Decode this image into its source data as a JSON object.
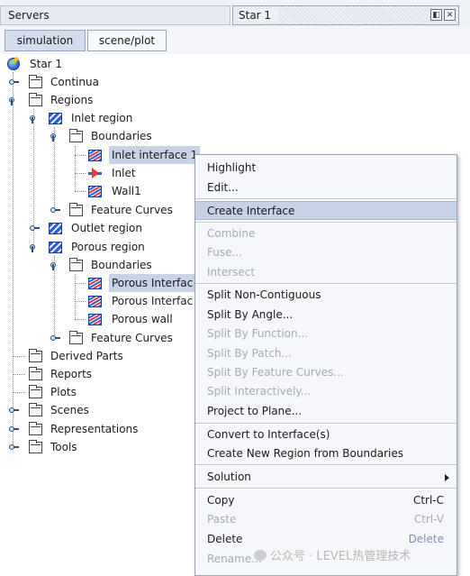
{
  "header": {
    "servers_label": "Servers",
    "tab_title": "Star 1",
    "restore_glyph": "◧",
    "close_glyph": "✕"
  },
  "tabs": [
    {
      "label": "simulation",
      "active": true
    },
    {
      "label": "scene/plot",
      "active": false
    }
  ],
  "tree": {
    "root": "Star 1",
    "continua": "Continua",
    "regions": "Regions",
    "inlet_region": "Inlet region",
    "boundaries": "Boundaries",
    "inlet_interface": "Inlet interface 1",
    "inlet": "Inlet",
    "wall1": "Wall1",
    "feature_curves": "Feature Curves",
    "outlet_region": "Outlet region",
    "porous_region": "Porous region",
    "porous_interface_a": "Porous Interfac",
    "porous_interface_b": "Porous Interfac",
    "porous_wall": "Porous wall",
    "derived_parts": "Derived Parts",
    "reports": "Reports",
    "plots": "Plots",
    "scenes": "Scenes",
    "representations": "Representations",
    "tools": "Tools"
  },
  "menu": {
    "highlight": "Highlight",
    "edit": "Edit...",
    "create_interface": "Create Interface",
    "combine": "Combine",
    "fuse": "Fuse...",
    "intersect": "Intersect",
    "split_non_contiguous": "Split Non-Contiguous",
    "split_by_angle": "Split By Angle...",
    "split_by_function": "Split By Function...",
    "split_by_patch": "Split By Patch...",
    "split_by_feature_curves": "Split By Feature Curves...",
    "split_interactively": "Split Interactively...",
    "project_to_plane": "Project to Plane...",
    "convert_to_interface": "Convert to Interface(s)",
    "create_new_region": "Create New Region from Boundaries",
    "solution": "Solution",
    "copy": "Copy",
    "copy_shortcut": "Ctrl-C",
    "paste": "Paste",
    "paste_shortcut": "Ctrl-V",
    "delete": "Delete",
    "delete_shortcut": "Delete",
    "rename": "Rename..."
  },
  "watermark": "公众号 · LEVEL热管理技术"
}
